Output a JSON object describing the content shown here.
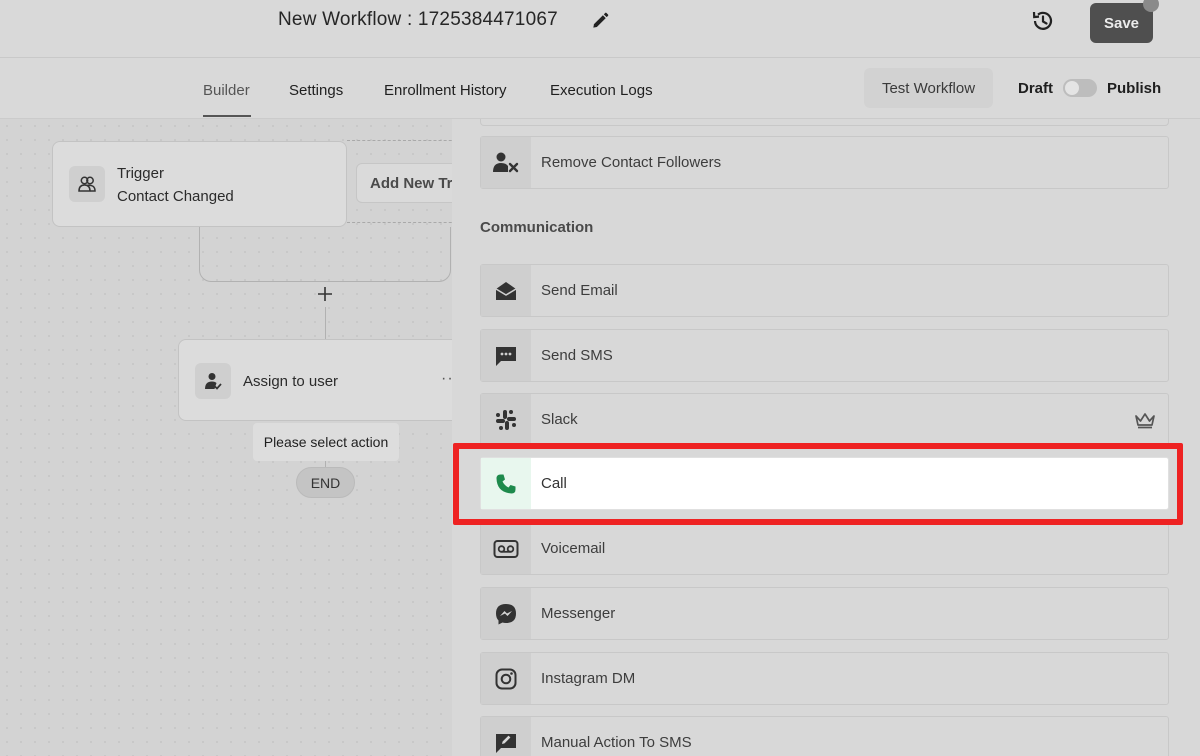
{
  "header": {
    "workflow_title": "New Workflow : 1725384471067",
    "save_label": "Save"
  },
  "tabs": [
    {
      "label": "Builder",
      "active": true
    },
    {
      "label": "Settings",
      "active": false
    },
    {
      "label": "Enrollment History",
      "active": false
    },
    {
      "label": "Execution Logs",
      "active": false
    }
  ],
  "toolbar": {
    "test_label": "Test Workflow",
    "draft_label": "Draft",
    "publish_label": "Publish",
    "published": false
  },
  "canvas": {
    "trigger": {
      "title": "Trigger",
      "subtitle": "Contact Changed"
    },
    "add_trigger_label": "Add New Tr",
    "assign_label": "Assign to user",
    "more_label": "··",
    "tooltip": "Please select action",
    "end_label": "END"
  },
  "panel": {
    "first_item": {
      "label": "Remove Contact Followers",
      "icon": "remove-user-icon"
    },
    "section": "Communication",
    "items": [
      {
        "label": "Send Email",
        "icon": "envelope-open-icon",
        "premium": false,
        "highlighted": false
      },
      {
        "label": "Send SMS",
        "icon": "chat-bubble-icon",
        "premium": false,
        "highlighted": false
      },
      {
        "label": "Slack",
        "icon": "slack-icon",
        "premium": true,
        "highlighted": false
      },
      {
        "label": "Call",
        "icon": "phone-icon",
        "premium": false,
        "highlighted": true
      },
      {
        "label": "Voicemail",
        "icon": "voicemail-icon",
        "premium": false,
        "highlighted": false
      },
      {
        "label": "Messenger",
        "icon": "messenger-icon",
        "premium": false,
        "highlighted": false
      },
      {
        "label": "Instagram DM",
        "icon": "instagram-icon",
        "premium": false,
        "highlighted": false
      },
      {
        "label": "Manual Action To SMS",
        "icon": "manual-sms-icon",
        "premium": false,
        "highlighted": false
      }
    ]
  },
  "colors": {
    "highlight_frame": "#ee2222",
    "call_icon": "#1e8a4c",
    "save_button": "#4f4f4f"
  }
}
